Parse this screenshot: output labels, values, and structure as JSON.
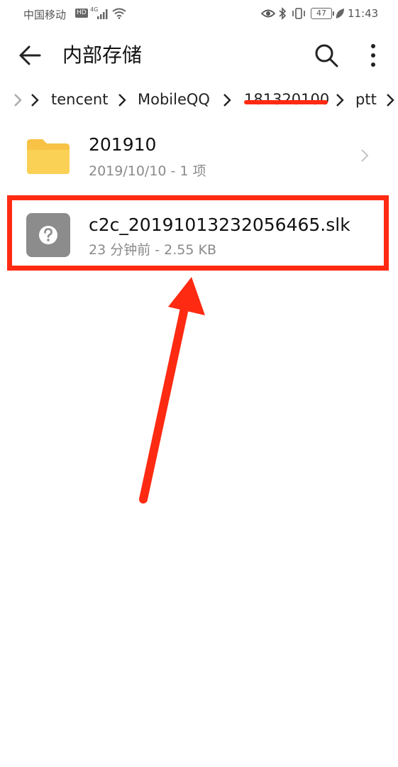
{
  "status_bar": {
    "carrier": "中国移动",
    "hd_badge": "HD",
    "network_gen": "4G",
    "battery_level": "47",
    "time": "11:43",
    "icons": [
      "signal-icon",
      "wifi-icon",
      "eye-icon",
      "bluetooth-icon",
      "vibrate-icon",
      "battery-icon",
      "leaf-icon"
    ]
  },
  "header": {
    "title": "内部存储",
    "icons": [
      "back-arrow-icon",
      "search-icon",
      "more-vertical-icon"
    ]
  },
  "breadcrumb": {
    "items": [
      {
        "label": "tencent"
      },
      {
        "label": "MobileQQ"
      },
      {
        "label": "181320100"
      },
      {
        "label": "ptt"
      }
    ],
    "separator_icon": "chevron-right-icon"
  },
  "files": [
    {
      "name": "201910",
      "meta": "2019/10/10 - 1 项",
      "type": "folder",
      "icon": "folder-icon",
      "color": "#f7c245"
    },
    {
      "name": "c2c_20191013232056465.slk",
      "meta": "23 分钟前 - 2.55 KB",
      "type": "unknown-file",
      "icon": "unknown-file-icon",
      "color": "#8c8c8c"
    }
  ],
  "annotation": {
    "color": "#ff2a12"
  }
}
